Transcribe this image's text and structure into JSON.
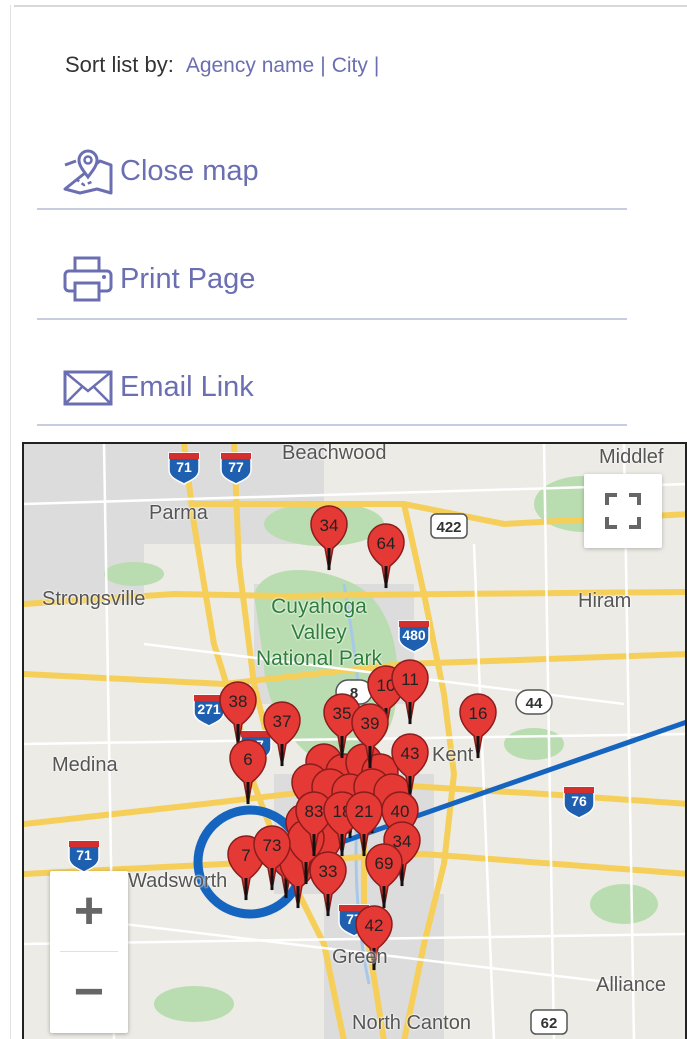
{
  "sort": {
    "label": "Sort list by:",
    "options": [
      "Agency name",
      "City"
    ]
  },
  "actions": [
    {
      "label": "Close map",
      "icon": "map-pin-icon"
    },
    {
      "label": "Print Page",
      "icon": "printer-icon"
    },
    {
      "label": "Email Link",
      "icon": "envelope-icon"
    }
  ],
  "colors": {
    "link": "#6b6fb1",
    "marker": "#e53935",
    "highlight": "#1565c0",
    "park": "#b9ddb0"
  },
  "map": {
    "places": {
      "beachwood": "Beachwood",
      "middlefield": "Middlef",
      "parma": "Parma",
      "strongsville": "Strongsville",
      "cvnp_1": "Cuyahoga",
      "cvnp_2": "Valley",
      "cvnp_3": "National Park",
      "hiram": "Hiram",
      "kent": "Kent",
      "medina": "Medina",
      "wadsworth": "Wadsworth",
      "green": "Green",
      "alliance": "Alliance",
      "north_canton": "North Canton"
    },
    "shields": [
      "71",
      "77",
      "422",
      "480",
      "8",
      "44",
      "271",
      "77",
      "76",
      "71",
      "77",
      "62"
    ],
    "markers": [
      "34",
      "64",
      "10",
      "11",
      "16",
      "38",
      "37",
      "35",
      "39",
      "6",
      "43",
      "83",
      "18",
      "21",
      "40",
      "34",
      "69",
      "7",
      "73",
      "33",
      "42"
    ],
    "controls": {
      "zoom_in": "+",
      "zoom_out": "−"
    }
  }
}
